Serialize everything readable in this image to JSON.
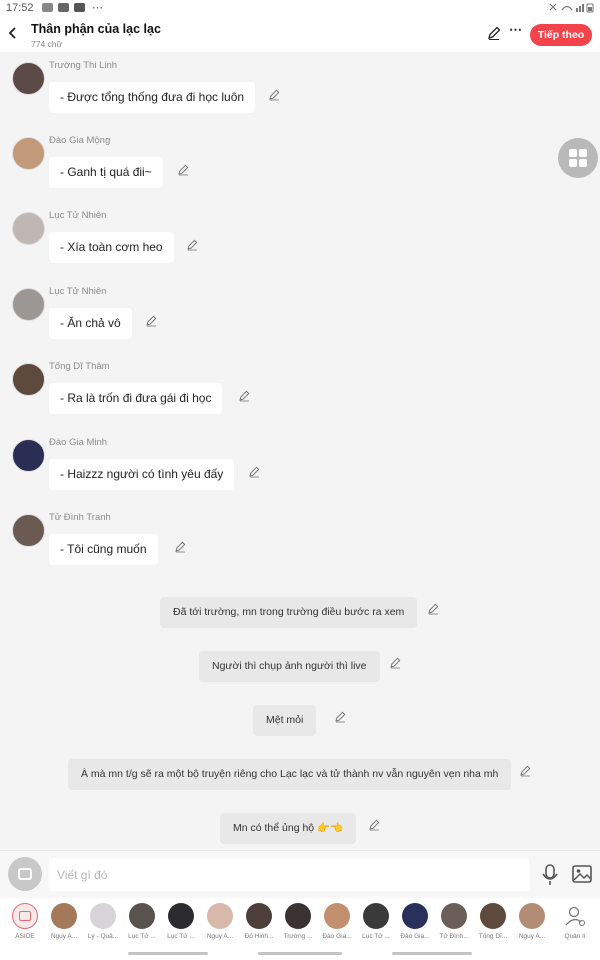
{
  "status_bar": {
    "time": "17:52",
    "dots": "⋯"
  },
  "header": {
    "title": "Thân phận của lạc lạc",
    "word_count": "774 chữ",
    "next_label": "Tiếp theo"
  },
  "messages": [
    {
      "sender": "Trường Thi Linh",
      "text": "- Được tổng thống đưa đi học luôn",
      "avatar_color": "#5b4a45"
    },
    {
      "sender": "Đào Gia Mộng",
      "text": "- Ganh tị quá đii~",
      "avatar_color": "#c29a7a"
    },
    {
      "sender": "Lục Tử Nhiên",
      "text": "- Xía toàn cơm heo",
      "avatar_color": "#bfb7b4"
    },
    {
      "sender": "Lục Tử Nhiên",
      "text": "- Ăn chả vô",
      "avatar_color": "#9d9794"
    },
    {
      "sender": "Tống Dĩ Thâm",
      "text": "- Ra là trốn đi đưa gái đi học",
      "avatar_color": "#5e4a3d"
    },
    {
      "sender": "Đào Gia Minh",
      "text": "- Haizzz người có tình yêu đấy",
      "avatar_color": "#2a2e52"
    },
    {
      "sender": "Tử Đình Tranh",
      "text": "- Tôi cũng muốn",
      "avatar_color": "#6a5a52"
    }
  ],
  "narrations": [
    "Đã tới trường, mn trong trường điều bước ra xem",
    "Người thì chụp ảnh người thì live",
    "Mệt mỏi",
    "À mà mn t/g sẽ ra một bộ truyện riêng cho Lạc lạc và tử thành nv vẫn nguyên vẹn nha mh",
    "Mn có thể ủng hộ 👉👈"
  ],
  "input": {
    "placeholder": "Viết gì đó"
  },
  "characters": [
    {
      "label": "ASIDE",
      "color": "#f7e8e9"
    },
    {
      "label": "Nguy A...",
      "color": "#a4795a"
    },
    {
      "label": "Lý - Quả...",
      "color": "#d7d3d8"
    },
    {
      "label": "Lục Tử ...",
      "color": "#5a524c"
    },
    {
      "label": "Lục Tử ...",
      "color": "#2c2b2e"
    },
    {
      "label": "Nguy A...",
      "color": "#d7b8aa"
    },
    {
      "label": "Đỗ Hinh...",
      "color": "#4d3f3a"
    },
    {
      "label": "Trường ...",
      "color": "#3b3232"
    },
    {
      "label": "Đào Gia...",
      "color": "#c2906f"
    },
    {
      "label": "Lục Tử ...",
      "color": "#3a3a3a"
    },
    {
      "label": "Đào Gia...",
      "color": "#29305c"
    },
    {
      "label": "Tử Đình...",
      "color": "#6b5d57"
    },
    {
      "label": "Tống Dĩ...",
      "color": "#5e4a3d"
    },
    {
      "label": "Nguy A...",
      "color": "#b28c74"
    },
    {
      "label": "Quản lí",
      "color": "#ffffff"
    }
  ],
  "colors": {
    "accent": "#f5434b",
    "bubble": "#ffffff",
    "narration": "#e8e8e8",
    "background": "#f4f4f4"
  }
}
